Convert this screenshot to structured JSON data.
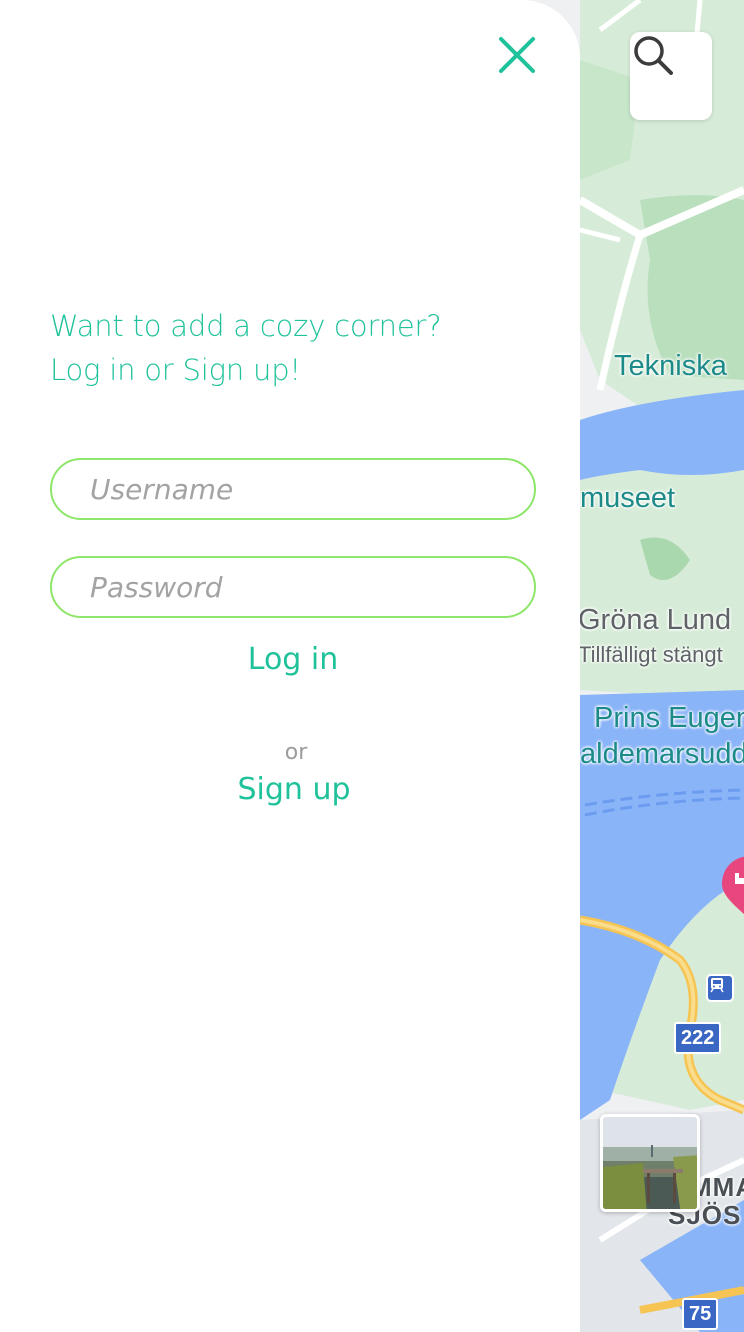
{
  "panel": {
    "close_icon": "close-icon",
    "prompt_line1": "Want to add a cozy corner?",
    "prompt_line2": "Log in or Sign up!",
    "username_placeholder": "Username",
    "password_placeholder": "Password",
    "login_label": "Log in",
    "or_label": "or",
    "signup_label": "Sign up"
  },
  "map": {
    "search_icon": "search-icon",
    "labels": {
      "tekniska": "Tekniska",
      "museet": "museet",
      "grona_lund": "Gröna Lund",
      "grona_lund_status": "Tillfälligt stängt",
      "prins_eugen": "Prins Eugen",
      "waldemarsudde": "aldemarsudde",
      "hammarby_1": "MMA",
      "hammarby_2": "SJÖS"
    },
    "road_shields": [
      "222",
      "75"
    ],
    "poi_icons": [
      "hotel-pin-icon",
      "metro-icon",
      "photo-thumbnail"
    ]
  },
  "colors": {
    "accent": "#1fc29a",
    "field_border": "#8ee66a",
    "water": "#8ab4f8",
    "park": "#c8e6c9",
    "road_major": "#f6c453"
  }
}
